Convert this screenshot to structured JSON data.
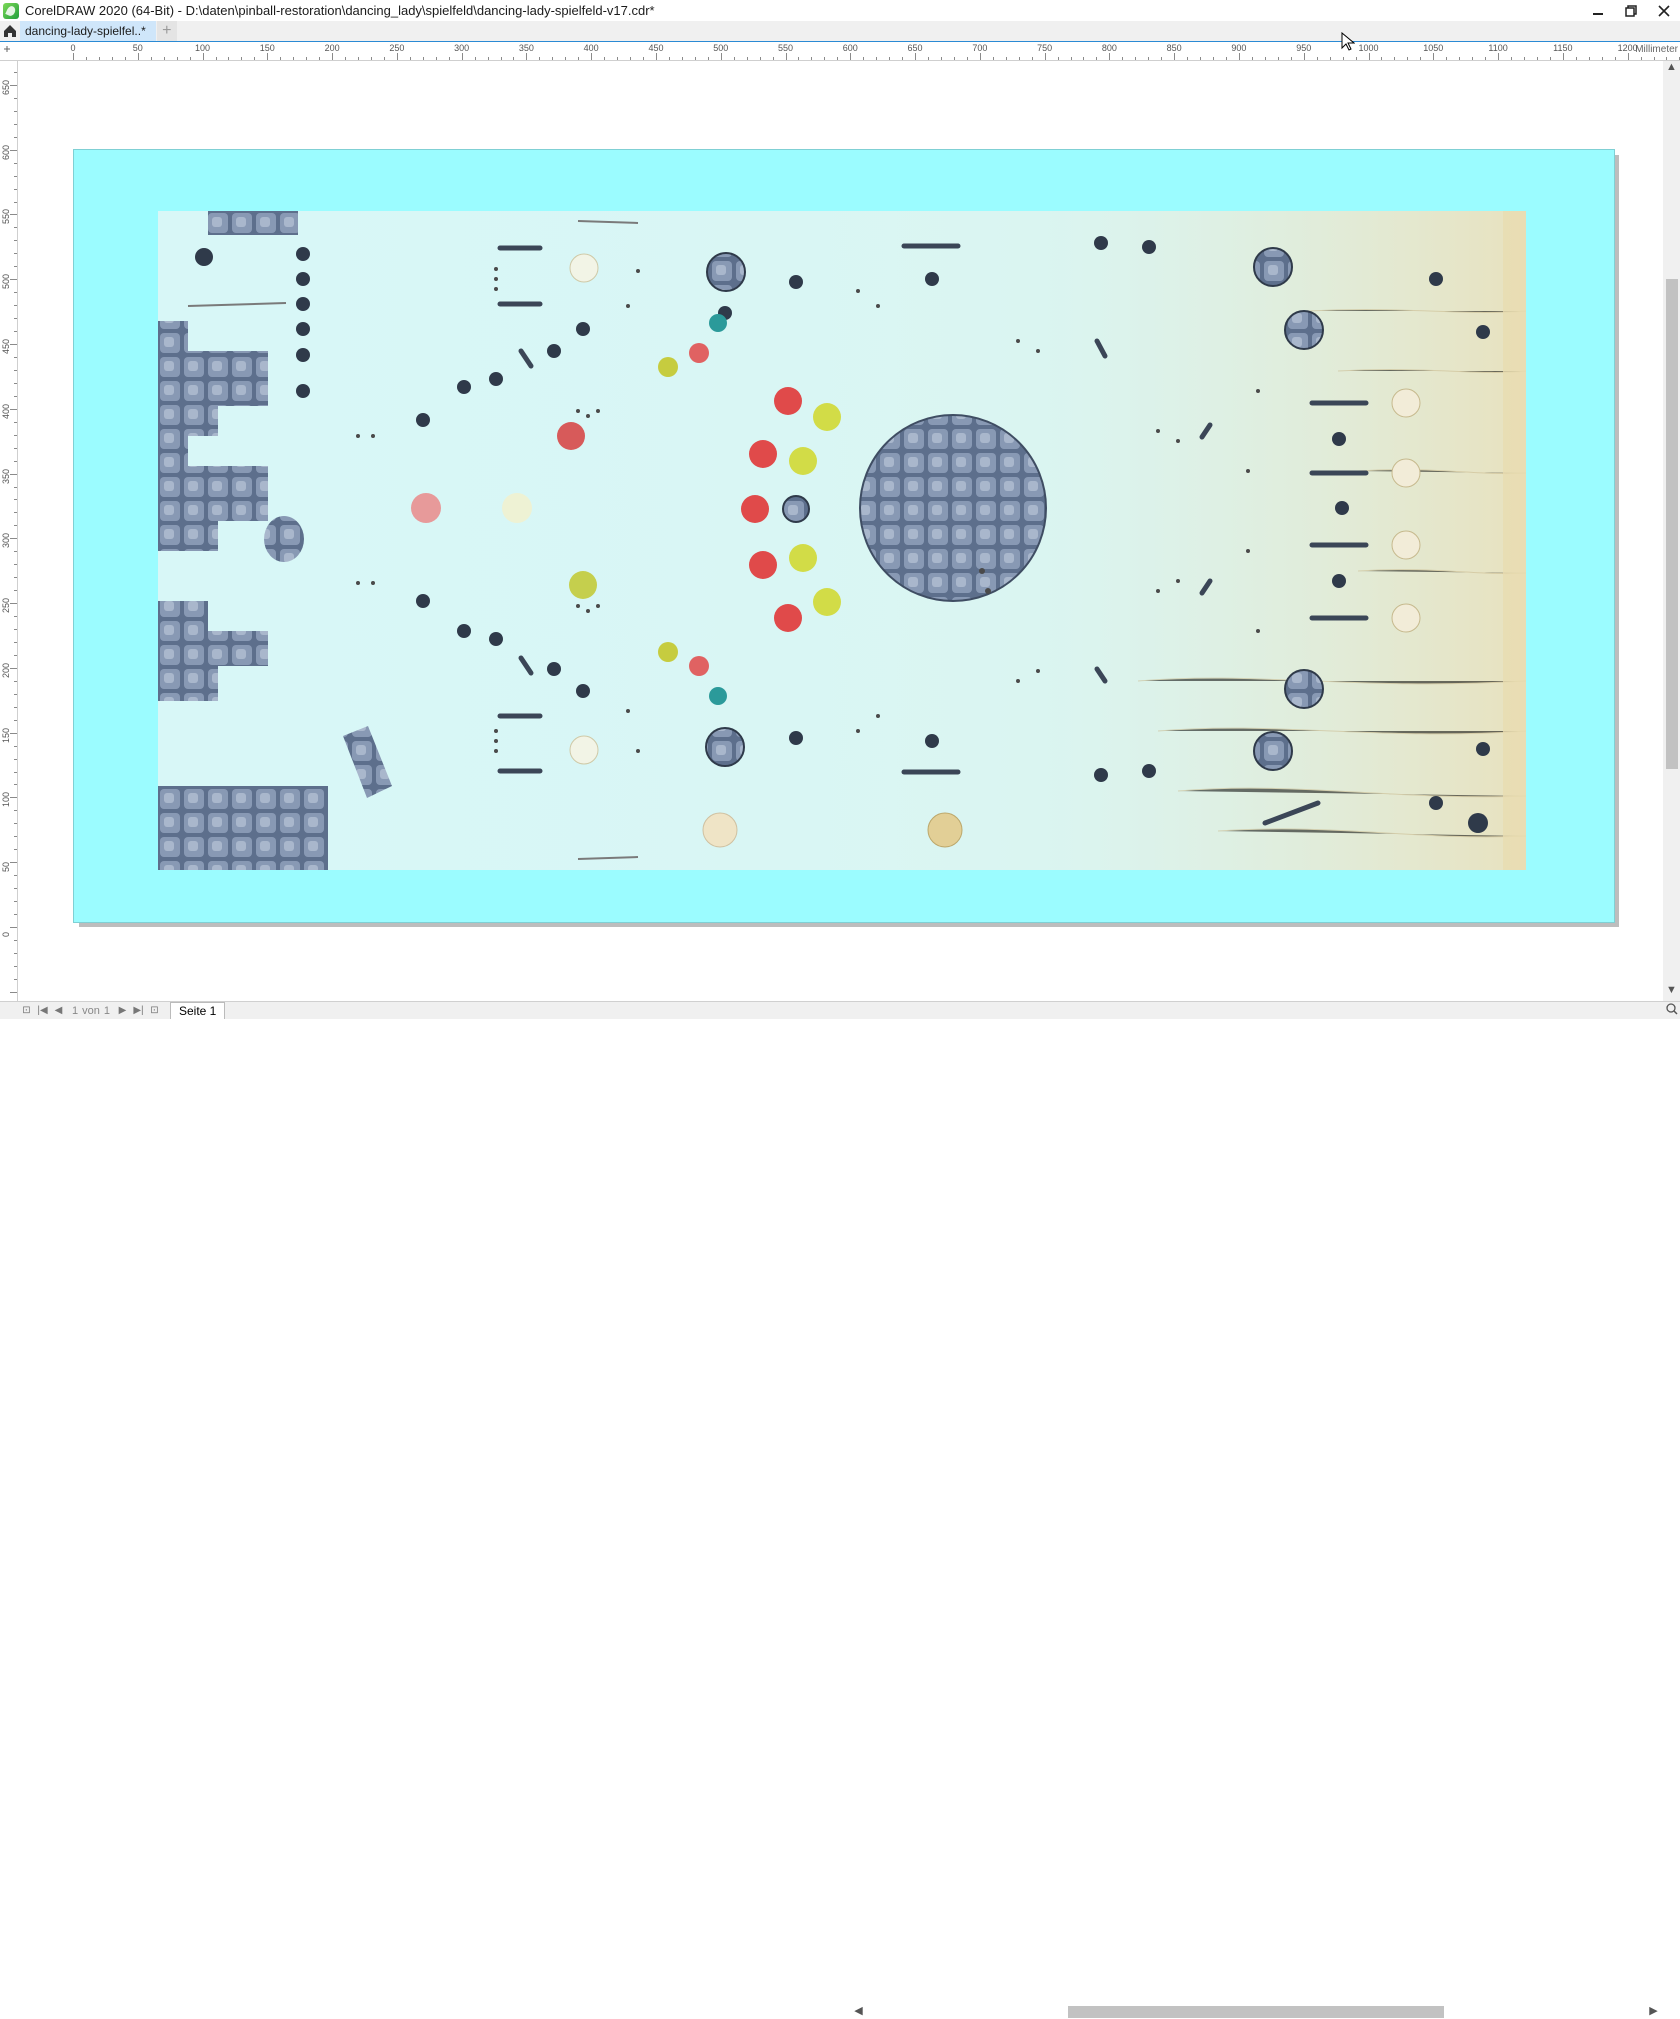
{
  "window": {
    "title": "CorelDRAW 2020 (64-Bit) - D:\\daten\\pinball-restoration\\dancing_lady\\spielfeld\\dancing-lady-spielfeld-v17.cdr*"
  },
  "tabs": [
    {
      "label": "dancing-lady-spielfel..*",
      "active": true
    }
  ],
  "ruler": {
    "unit": "Millimeter",
    "h_ticks": [
      "0",
      "50",
      "100",
      "150",
      "200",
      "250",
      "300",
      "350",
      "400",
      "450",
      "500",
      "550",
      "600",
      "650",
      "700",
      "750",
      "800",
      "850",
      "900",
      "950",
      "1000",
      "1050",
      "1100",
      "1150",
      "1200"
    ],
    "v_ticks": [
      "650",
      "600",
      "550",
      "500",
      "450",
      "400",
      "350",
      "300",
      "250",
      "200",
      "150",
      "100",
      "50",
      "0"
    ]
  },
  "page_nav": {
    "current": "1",
    "of_label": "von",
    "total": "1",
    "page_tab": "Seite 1"
  },
  "colors": {
    "page_fill": "#9bfcff",
    "playfield": "#d8f7f7",
    "accent": "#2a8ad4"
  }
}
